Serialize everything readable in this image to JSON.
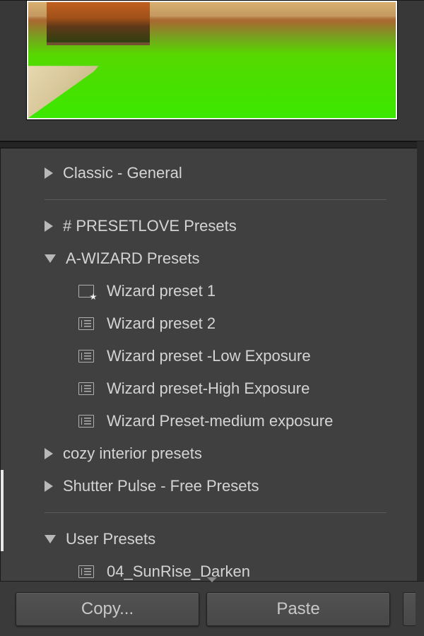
{
  "presets_panel": {
    "section_top": {
      "groups": [
        {
          "label": "Classic - General",
          "expanded": false
        }
      ]
    },
    "section_mid": {
      "groups": [
        {
          "label": "# PRESETLOVE Presets",
          "expanded": false
        },
        {
          "label": "A-WIZARD Presets",
          "expanded": true,
          "items": [
            {
              "label": "Wizard preset 1",
              "starred": true
            },
            {
              "label": "Wizard preset 2",
              "starred": false
            },
            {
              "label": "Wizard preset -Low Exposure",
              "starred": false
            },
            {
              "label": "Wizard preset-High Exposure",
              "starred": false
            },
            {
              "label": "Wizard Preset-medium exposure",
              "starred": false
            }
          ]
        },
        {
          "label": "cozy interior presets",
          "expanded": false
        },
        {
          "label": "Shutter Pulse - Free Presets",
          "expanded": false
        }
      ]
    },
    "section_bot": {
      "groups": [
        {
          "label": "User Presets",
          "expanded": true,
          "items": [
            {
              "label": "04_SunRise_Darken",
              "starred": false
            }
          ]
        }
      ]
    }
  },
  "buttons": {
    "copy": "Copy...",
    "paste": "Paste"
  }
}
